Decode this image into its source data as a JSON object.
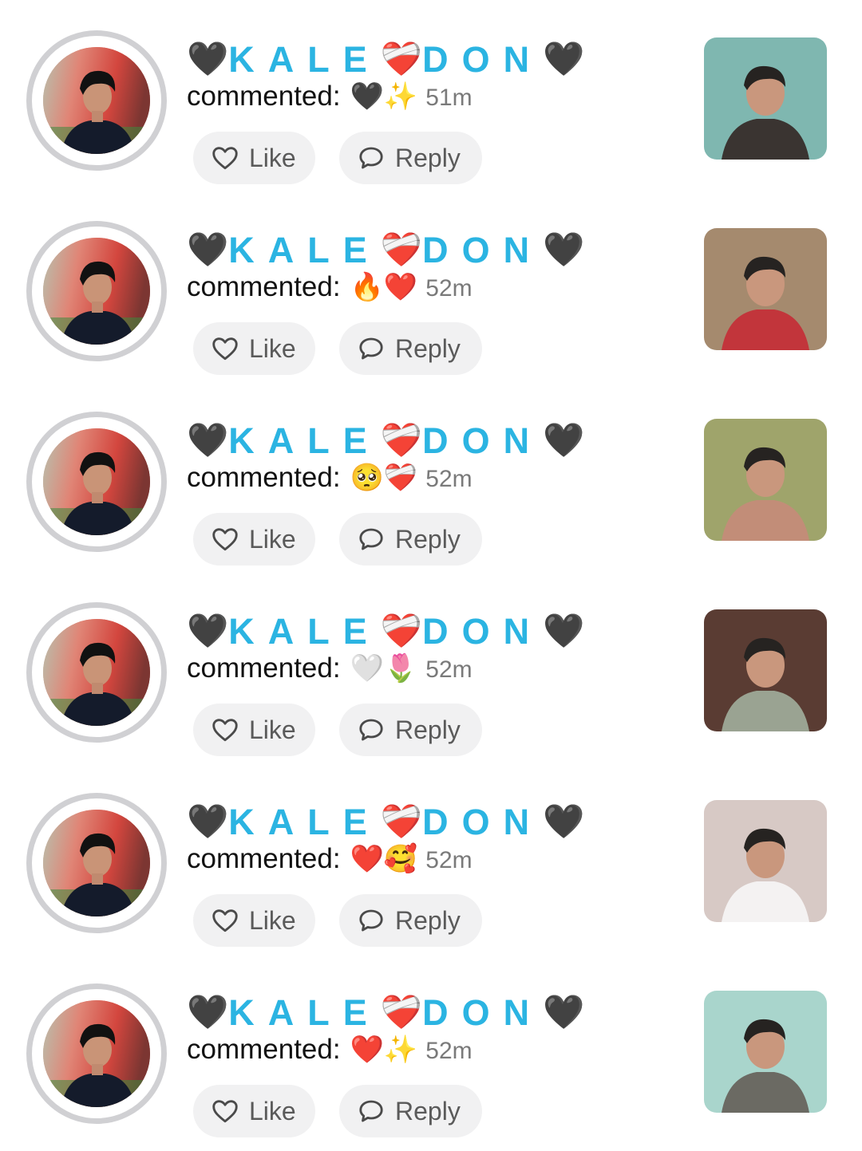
{
  "comments": [
    {
      "name": "KALE",
      "name_tail": "DON",
      "label": "commented:",
      "emojis": "🖤✨",
      "time": "51m",
      "like": "Like",
      "reply": "Reply",
      "thumb_bg": "#7fb7b0",
      "thumb_accent": "#3a3431"
    },
    {
      "name": "KALE",
      "name_tail": "DON",
      "label": "commented:",
      "emojis": "🔥❤️",
      "time": "52m",
      "like": "Like",
      "reply": "Reply",
      "thumb_bg": "#a58a6e",
      "thumb_accent": "#c2353b"
    },
    {
      "name": "KALE",
      "name_tail": "DON",
      "label": "commented:",
      "emojis": "🥺❤️‍🩹",
      "time": "52m",
      "like": "Like",
      "reply": "Reply",
      "thumb_bg": "#9fa46b",
      "thumb_accent": "#c28d78"
    },
    {
      "name": "KALE",
      "name_tail": "DON",
      "label": "commented:",
      "emojis": "🤍🌷",
      "time": "52m",
      "like": "Like",
      "reply": "Reply",
      "thumb_bg": "#5a3c33",
      "thumb_accent": "#9aa392"
    },
    {
      "name": "KALE",
      "name_tail": "DON",
      "label": "commented:",
      "emojis": "❤️🥰",
      "time": "52m",
      "like": "Like",
      "reply": "Reply",
      "thumb_bg": "#d7c9c5",
      "thumb_accent": "#f4f2f2"
    },
    {
      "name": "KALE",
      "name_tail": "DON",
      "label": "commented:",
      "emojis": "❤️✨",
      "time": "52m",
      "like": "Like",
      "reply": "Reply",
      "thumb_bg": "#a9d5cc",
      "thumb_accent": "#6b6a63"
    }
  ],
  "decor": {
    "black_heart": "🖤",
    "mending_heart": "❤️‍🩹"
  },
  "colors": {
    "name": "#2bb4e2",
    "button_bg": "#f1f1f2",
    "ring": "#d0d0d3",
    "time": "#7a7a7a"
  },
  "icons": {
    "like": "heart-outline-icon",
    "reply": "speech-bubble-icon"
  }
}
